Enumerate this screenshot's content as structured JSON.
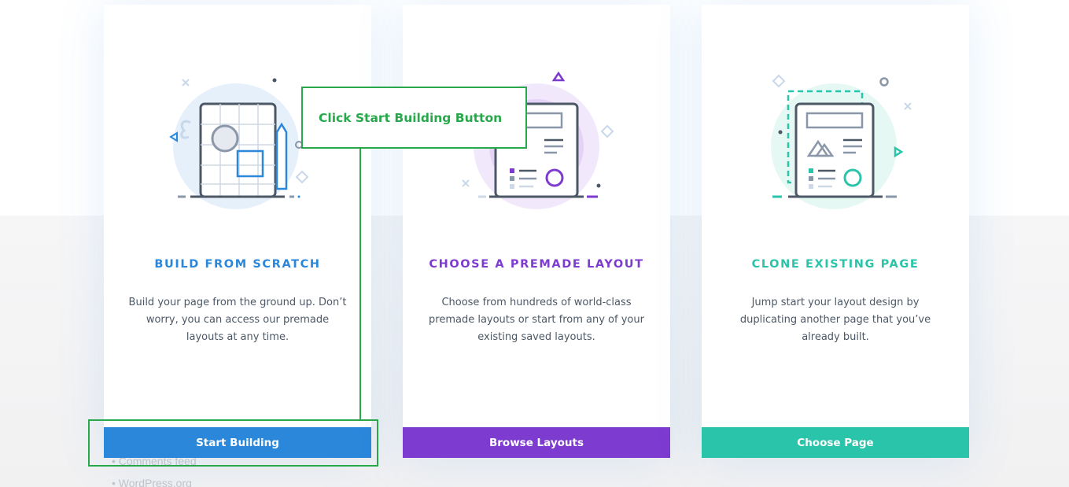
{
  "cards": [
    {
      "title": "BUILD FROM SCRATCH",
      "description": "Build your page from the ground up. Don’t worry, you can access our premade layouts at any time.",
      "button_label": "Start Building",
      "accent": "#2b87da"
    },
    {
      "title": "CHOOSE A PREMADE LAYOUT",
      "description": "Choose from hundreds of world-class premade layouts or start from any of your existing saved layouts.",
      "button_label": "Browse Layouts",
      "accent": "#7e3bd0"
    },
    {
      "title": "CLONE EXISTING PAGE",
      "description": "Jump start your layout design by duplicating another page that you’ve already built.",
      "button_label": "Choose Page",
      "accent": "#29c4a9"
    }
  ],
  "annotation": {
    "text": "Click Start Building Button",
    "color": "#27a84a"
  },
  "background_footer": {
    "items": [
      "Comments feed",
      "WordPress.org"
    ]
  },
  "icons": [
    "blueprint-illustration-icon",
    "layout-illustration-icon",
    "clone-page-illustration-icon"
  ]
}
